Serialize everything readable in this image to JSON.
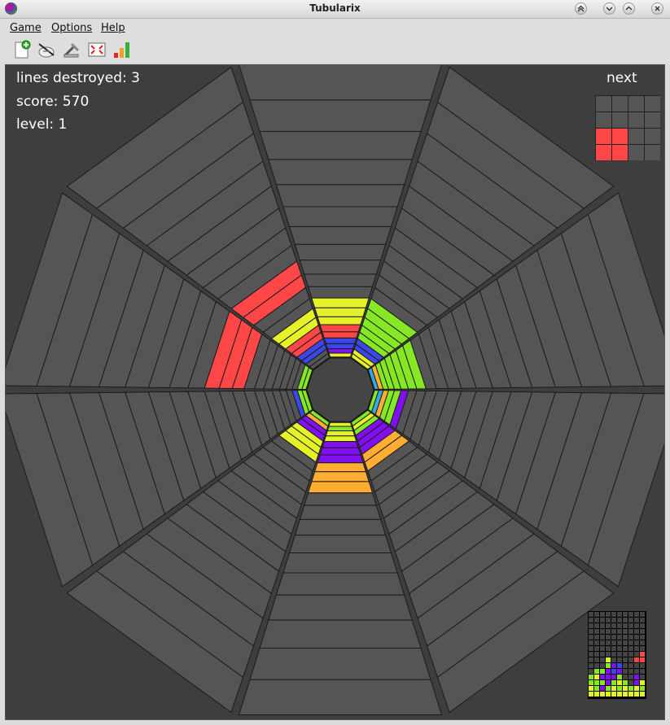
{
  "window": {
    "title": "Tubularix",
    "buttons": [
      "keep-above",
      "minimize",
      "maximize",
      "close"
    ]
  },
  "menu": {
    "items": [
      {
        "id": "game",
        "label": "Game"
      },
      {
        "id": "options",
        "label": "Options"
      },
      {
        "id": "help",
        "label": "Help"
      }
    ]
  },
  "toolbar": {
    "actions": [
      {
        "id": "new-game",
        "icon": "new-game-icon"
      },
      {
        "id": "pause",
        "icon": "pause-icon"
      },
      {
        "id": "settings",
        "icon": "settings-icon"
      },
      {
        "id": "fullscreen",
        "icon": "fullscreen-icon"
      },
      {
        "id": "high-scores",
        "icon": "high-scores-icon"
      }
    ]
  },
  "hud": {
    "lines_destroyed": "lines destroyed: 3",
    "score": "score: 570",
    "level": "level: 1",
    "next_label": "next"
  },
  "colors": {
    "background": "#3e3e3e",
    "empty_cell": "#555555",
    "grid_line": "#1a1a1a",
    "yellow": "#e5f22a",
    "green": "#86e825",
    "red": "#ff4747",
    "blue": "#3b47e6",
    "purple": "#8010f2",
    "orange": "#ffad33",
    "cyan": "#33a8e6"
  },
  "next_piece": {
    "color": "#ff4747",
    "cells": [
      [
        0,
        0,
        0,
        0
      ],
      [
        0,
        0,
        0,
        0
      ],
      [
        1,
        1,
        0,
        0
      ],
      [
        1,
        1,
        0,
        0
      ]
    ]
  },
  "board": {
    "sectors": 10,
    "depth": 20,
    "blocks": [
      {
        "sector": 0,
        "depth": 0,
        "color": "yellow"
      },
      {
        "sector": 0,
        "depth": 1,
        "color": "purple"
      },
      {
        "sector": 0,
        "depth": 2,
        "color": "blue"
      },
      {
        "sector": 0,
        "depth": 3,
        "color": "blue"
      },
      {
        "sector": 0,
        "depth": 4,
        "color": "red"
      },
      {
        "sector": 0,
        "depth": 5,
        "color": "red"
      },
      {
        "sector": 0,
        "depth": 6,
        "color": "yellow"
      },
      {
        "sector": 0,
        "depth": 7,
        "color": "yellow"
      },
      {
        "sector": 0,
        "depth": 8,
        "color": "yellow"
      },
      {
        "sector": 1,
        "depth": 0,
        "color": "yellow"
      },
      {
        "sector": 1,
        "depth": 1,
        "color": "yellow"
      },
      {
        "sector": 1,
        "depth": 2,
        "color": "blue"
      },
      {
        "sector": 1,
        "depth": 3,
        "color": "blue"
      },
      {
        "sector": 1,
        "depth": 4,
        "color": "green"
      },
      {
        "sector": 1,
        "depth": 5,
        "color": "green"
      },
      {
        "sector": 1,
        "depth": 6,
        "color": "green"
      },
      {
        "sector": 1,
        "depth": 7,
        "color": "green"
      },
      {
        "sector": 1,
        "depth": 8,
        "color": "green"
      },
      {
        "sector": 2,
        "depth": 0,
        "color": "cyan"
      },
      {
        "sector": 2,
        "depth": 1,
        "color": "orange"
      },
      {
        "sector": 2,
        "depth": 2,
        "color": "green"
      },
      {
        "sector": 2,
        "depth": 3,
        "color": "green"
      },
      {
        "sector": 2,
        "depth": 4,
        "color": "green"
      },
      {
        "sector": 2,
        "depth": 5,
        "color": "green"
      },
      {
        "sector": 2,
        "depth": 6,
        "color": "green"
      },
      {
        "sector": 2,
        "depth": 7,
        "color": "green"
      },
      {
        "sector": 3,
        "depth": 0,
        "color": "green"
      },
      {
        "sector": 3,
        "depth": 1,
        "color": "cyan"
      },
      {
        "sector": 3,
        "depth": 2,
        "color": "orange"
      },
      {
        "sector": 3,
        "depth": 3,
        "color": "green"
      },
      {
        "sector": 3,
        "depth": 4,
        "color": "green"
      },
      {
        "sector": 3,
        "depth": 5,
        "color": "purple"
      },
      {
        "sector": 4,
        "depth": 0,
        "color": "green"
      },
      {
        "sector": 4,
        "depth": 1,
        "color": "yellow"
      },
      {
        "sector": 4,
        "depth": 2,
        "color": "green"
      },
      {
        "sector": 4,
        "depth": 3,
        "color": "purple"
      },
      {
        "sector": 4,
        "depth": 4,
        "color": "purple"
      },
      {
        "sector": 4,
        "depth": 5,
        "color": "purple"
      },
      {
        "sector": 4,
        "depth": 6,
        "color": "orange"
      },
      {
        "sector": 4,
        "depth": 7,
        "color": "orange"
      },
      {
        "sector": 5,
        "depth": 0,
        "color": "yellow"
      },
      {
        "sector": 5,
        "depth": 1,
        "color": "green"
      },
      {
        "sector": 5,
        "depth": 2,
        "color": "yellow"
      },
      {
        "sector": 5,
        "depth": 3,
        "color": "yellow"
      },
      {
        "sector": 5,
        "depth": 4,
        "color": "purple"
      },
      {
        "sector": 5,
        "depth": 5,
        "color": "purple"
      },
      {
        "sector": 5,
        "depth": 6,
        "color": "purple"
      },
      {
        "sector": 5,
        "depth": 7,
        "color": "orange"
      },
      {
        "sector": 5,
        "depth": 8,
        "color": "orange"
      },
      {
        "sector": 5,
        "depth": 9,
        "color": "orange"
      },
      {
        "sector": 6,
        "depth": 0,
        "color": "green"
      },
      {
        "sector": 6,
        "depth": 1,
        "color": "orange"
      },
      {
        "sector": 6,
        "depth": 2,
        "color": "purple"
      },
      {
        "sector": 6,
        "depth": 3,
        "color": "purple"
      },
      {
        "sector": 6,
        "depth": 4,
        "color": "yellow"
      },
      {
        "sector": 6,
        "depth": 5,
        "color": "yellow"
      },
      {
        "sector": 6,
        "depth": 6,
        "color": "yellow"
      },
      {
        "sector": 7,
        "depth": 0,
        "color": "green"
      },
      {
        "sector": 7,
        "depth": 1,
        "color": "green"
      },
      {
        "sector": 7,
        "depth": 2,
        "color": "blue"
      },
      {
        "sector": 8,
        "depth": 0,
        "color": "green"
      },
      {
        "sector": 8,
        "depth": 1,
        "color": "green"
      },
      {
        "sector": 8,
        "depth": 9,
        "color": "red"
      },
      {
        "sector": 8,
        "depth": 10,
        "color": "red"
      },
      {
        "sector": 8,
        "depth": 11,
        "color": "red"
      },
      {
        "sector": 9,
        "depth": 2,
        "color": "blue"
      },
      {
        "sector": 9,
        "depth": 3,
        "color": "blue"
      },
      {
        "sector": 9,
        "depth": 4,
        "color": "red"
      },
      {
        "sector": 9,
        "depth": 5,
        "color": "red"
      },
      {
        "sector": 9,
        "depth": 6,
        "color": "yellow"
      },
      {
        "sector": 9,
        "depth": 7,
        "color": "yellow"
      },
      {
        "sector": 9,
        "depth": 10,
        "color": "red"
      },
      {
        "sector": 9,
        "depth": 11,
        "color": "red"
      }
    ]
  },
  "mini_map": {
    "columns": 10,
    "rows": 15,
    "cells": [
      "..........",
      "..........",
      "..........",
      "..........",
      "..........",
      "..........",
      "..........",
      ".........r",
      "...y....rr",
      "...gpb....",
      ".ggpbp....",
      "gypppg..p.",
      "gggpgyg.py",
      "ygpgygygyg",
      "yyyyyyyyyy"
    ]
  }
}
